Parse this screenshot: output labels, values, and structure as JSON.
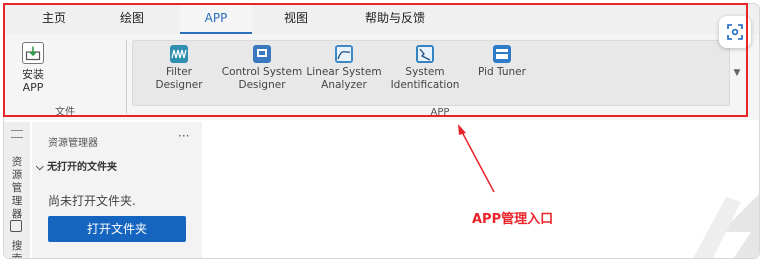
{
  "tabs": [
    {
      "label": "主页"
    },
    {
      "label": "绘图"
    },
    {
      "label": "APP"
    },
    {
      "label": "视图"
    },
    {
      "label": "帮助与反馈"
    }
  ],
  "file_section": {
    "install_label_line1": "安装",
    "install_label_line2": "APP",
    "title": "文件"
  },
  "app_section": {
    "title": "APP",
    "apps": [
      {
        "name_line1": "Filter Designer",
        "name_line2": "",
        "icon": "filter-designer-icon",
        "color": "#2f8fb0"
      },
      {
        "name_line1": "Control System",
        "name_line2": "Designer",
        "icon": "control-system-designer-icon",
        "color": "#3a78c2"
      },
      {
        "name_line1": "Linear System",
        "name_line2": "Analyzer",
        "icon": "linear-system-analyzer-icon",
        "color": "#3d88c7"
      },
      {
        "name_line1": "System",
        "name_line2": "Identification",
        "icon": "system-identification-icon",
        "color": "#3483c4"
      },
      {
        "name_line1": "Pid Tuner",
        "name_line2": "",
        "icon": "pid-tuner-icon",
        "color": "#2f7bc9"
      }
    ]
  },
  "left_panel": {
    "sidebar_tab1": "资源管理器",
    "sidebar_tab2": "搜索",
    "title": "资源管理器",
    "more": "···",
    "folder_header": "无打开的文件夹",
    "empty_text": "尚未打开文件夹.",
    "open_button": "打开文件夹"
  },
  "annotation": {
    "text": "APP管理入口",
    "color": "#e8242a"
  },
  "colors": {
    "accent": "#2a6ebd",
    "button": "#1565c0",
    "highlight": "#e8242a"
  }
}
